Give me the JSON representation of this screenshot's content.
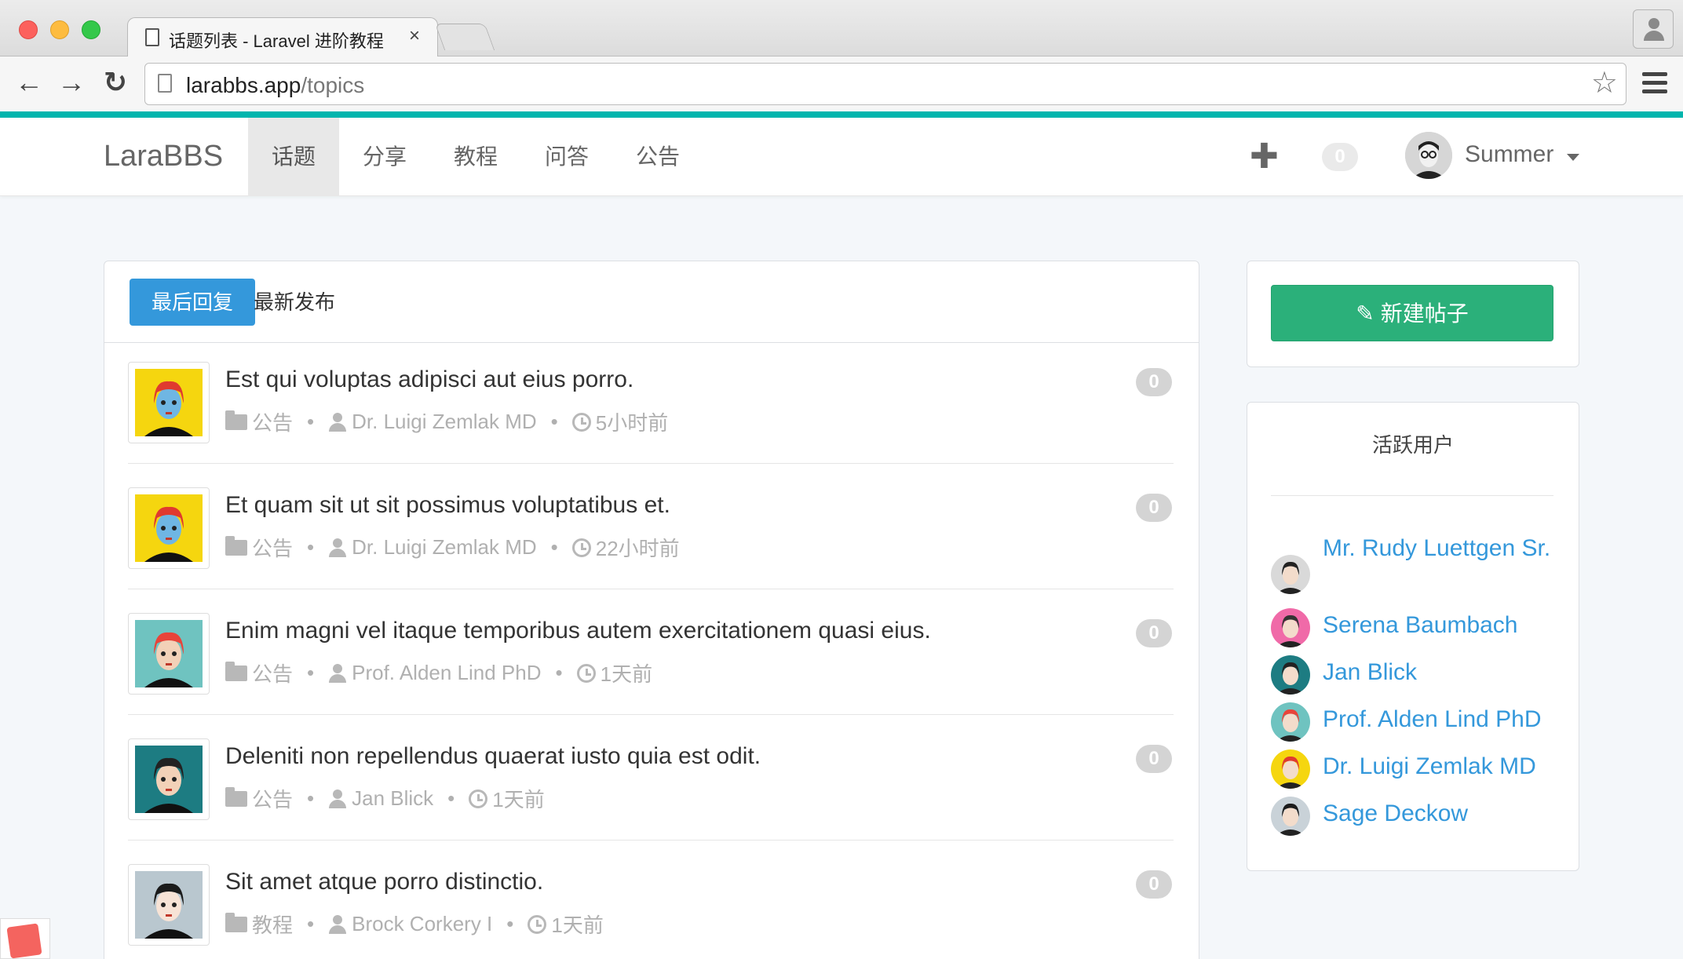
{
  "browser": {
    "tab_title": "话题列表 - Laravel 进阶教程",
    "tab_close": "×",
    "url_host": "larabbs.app",
    "url_path": "/topics",
    "star": "☆",
    "back": "←",
    "forward": "→",
    "reload": "↻"
  },
  "navbar": {
    "brand": "LaraBBS",
    "items": [
      "话题",
      "分享",
      "教程",
      "问答",
      "公告"
    ],
    "active_index": 0,
    "plus": "✚",
    "notification_count": "0",
    "user_name": "Summer"
  },
  "filters": {
    "last_reply": "最后回复",
    "latest": "最新发布"
  },
  "topics": [
    {
      "title": "Est qui voluptas adipisci aut eius porro.",
      "category": "公告",
      "author": "Dr. Luigi Zemlak MD",
      "time": "5小时前",
      "replies": "0",
      "avatar_bg": "#f5d60f",
      "avatar_hair": "#e03a2f",
      "avatar_skin": "#6fb6e3"
    },
    {
      "title": "Et quam sit ut sit possimus voluptatibus et.",
      "category": "公告",
      "author": "Dr. Luigi Zemlak MD",
      "time": "22小时前",
      "replies": "0",
      "avatar_bg": "#f5d60f",
      "avatar_hair": "#e03a2f",
      "avatar_skin": "#6fb6e3"
    },
    {
      "title": "Enim magni vel itaque temporibus autem exercitationem quasi eius.",
      "category": "公告",
      "author": "Prof. Alden Lind PhD",
      "time": "1天前",
      "replies": "0",
      "avatar_bg": "#6fc3c0",
      "avatar_hair": "#e8443a",
      "avatar_skin": "#f2d1b8"
    },
    {
      "title": "Deleniti non repellendus quaerat iusto quia est odit.",
      "category": "公告",
      "author": "Jan Blick",
      "time": "1天前",
      "replies": "0",
      "avatar_bg": "#1d7c82",
      "avatar_hair": "#222222",
      "avatar_skin": "#f2d1b8"
    },
    {
      "title": "Sit amet atque porro distinctio.",
      "category": "教程",
      "author": "Brock Corkery I",
      "time": "1天前",
      "replies": "0",
      "avatar_bg": "#b9c7cf",
      "avatar_hair": "#1b1b1b",
      "avatar_skin": "#f7e3d6"
    }
  ],
  "sidebar": {
    "new_post": "新建帖子",
    "pencil": "✎",
    "active_users_title": "活跃用户",
    "active_users": [
      {
        "name": "Mr. Rudy Luettgen Sr.",
        "bg": "#d9d9d9",
        "hair": "#222222"
      },
      {
        "name": "Serena Baumbach",
        "bg": "#f06aa8",
        "hair": "#333333"
      },
      {
        "name": "Jan Blick",
        "bg": "#1d7c82",
        "hair": "#222222"
      },
      {
        "name": "Prof. Alden Lind PhD",
        "bg": "#6fc3c0",
        "hair": "#e8443a"
      },
      {
        "name": "Dr. Luigi Zemlak MD",
        "bg": "#f5d60f",
        "hair": "#e03a2f"
      },
      {
        "name": "Sage Deckow",
        "bg": "#c9d2d8",
        "hair": "#1b1b1b"
      }
    ]
  },
  "colors": {
    "accent": "#00b5ad",
    "primary": "#3498db",
    "success": "#2bb07a"
  }
}
